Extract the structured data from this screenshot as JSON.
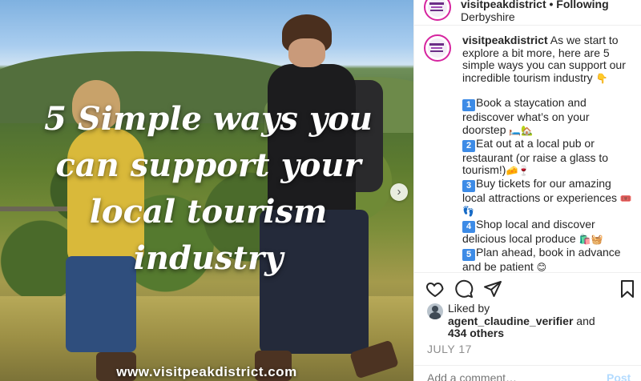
{
  "photo": {
    "overlay_title": "5 Simple ways you can support your local tourism industry",
    "overlay_url": "www.visitpeakdistrict.com",
    "next_icon": "chevron-right-icon"
  },
  "header": {
    "username": "visitpeakdistrict",
    "separator": "•",
    "follow_label": "Following",
    "location": "Derbyshire"
  },
  "caption": {
    "username": "visitpeakdistrict",
    "intro": "As we start to explore a bit more, here are 5 simple ways you can support our incredible tourism industry",
    "intro_emoji": "👇",
    "items": [
      {
        "num": "1",
        "text": "Book a staycation and rediscover what’s on your doorstep",
        "emoji": "🛏️🏡"
      },
      {
        "num": "2",
        "text": "Eat out at a local pub or restaurant (or raise a glass to tourism!)",
        "emoji": "🧀🍷"
      },
      {
        "num": "3",
        "text": "Buy tickets for our amazing local attractions or experiences",
        "emoji": "🎟️👣"
      },
      {
        "num": "4",
        "text": "Shop local and discover delicious local produce",
        "emoji": "🛍️🧺"
      },
      {
        "num": "5",
        "text": "Plan ahead, book in advance and be patient",
        "emoji": "😊"
      }
    ]
  },
  "actions": {
    "like_icon": "heart-icon",
    "comment_icon": "comment-icon",
    "share_icon": "share-icon",
    "save_icon": "bookmark-icon"
  },
  "likes": {
    "prefix": "Liked by",
    "user": "agent_claudine_verifier",
    "conj": "and",
    "others": "434 others"
  },
  "date": "JULY 17",
  "comment": {
    "placeholder": "Add a comment…",
    "post_label": "Post"
  }
}
